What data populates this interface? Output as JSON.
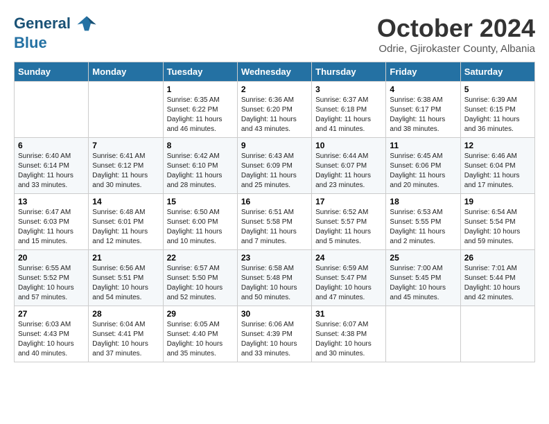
{
  "logo": {
    "line1": "General",
    "line2": "Blue"
  },
  "header": {
    "month": "October 2024",
    "location": "Odrie, Gjirokaster County, Albania"
  },
  "weekdays": [
    "Sunday",
    "Monday",
    "Tuesday",
    "Wednesday",
    "Thursday",
    "Friday",
    "Saturday"
  ],
  "weeks": [
    [
      {
        "day": "",
        "sunrise": "",
        "sunset": "",
        "daylight": ""
      },
      {
        "day": "",
        "sunrise": "",
        "sunset": "",
        "daylight": ""
      },
      {
        "day": "1",
        "sunrise": "Sunrise: 6:35 AM",
        "sunset": "Sunset: 6:22 PM",
        "daylight": "Daylight: 11 hours and 46 minutes."
      },
      {
        "day": "2",
        "sunrise": "Sunrise: 6:36 AM",
        "sunset": "Sunset: 6:20 PM",
        "daylight": "Daylight: 11 hours and 43 minutes."
      },
      {
        "day": "3",
        "sunrise": "Sunrise: 6:37 AM",
        "sunset": "Sunset: 6:18 PM",
        "daylight": "Daylight: 11 hours and 41 minutes."
      },
      {
        "day": "4",
        "sunrise": "Sunrise: 6:38 AM",
        "sunset": "Sunset: 6:17 PM",
        "daylight": "Daylight: 11 hours and 38 minutes."
      },
      {
        "day": "5",
        "sunrise": "Sunrise: 6:39 AM",
        "sunset": "Sunset: 6:15 PM",
        "daylight": "Daylight: 11 hours and 36 minutes."
      }
    ],
    [
      {
        "day": "6",
        "sunrise": "Sunrise: 6:40 AM",
        "sunset": "Sunset: 6:14 PM",
        "daylight": "Daylight: 11 hours and 33 minutes."
      },
      {
        "day": "7",
        "sunrise": "Sunrise: 6:41 AM",
        "sunset": "Sunset: 6:12 PM",
        "daylight": "Daylight: 11 hours and 30 minutes."
      },
      {
        "day": "8",
        "sunrise": "Sunrise: 6:42 AM",
        "sunset": "Sunset: 6:10 PM",
        "daylight": "Daylight: 11 hours and 28 minutes."
      },
      {
        "day": "9",
        "sunrise": "Sunrise: 6:43 AM",
        "sunset": "Sunset: 6:09 PM",
        "daylight": "Daylight: 11 hours and 25 minutes."
      },
      {
        "day": "10",
        "sunrise": "Sunrise: 6:44 AM",
        "sunset": "Sunset: 6:07 PM",
        "daylight": "Daylight: 11 hours and 23 minutes."
      },
      {
        "day": "11",
        "sunrise": "Sunrise: 6:45 AM",
        "sunset": "Sunset: 6:06 PM",
        "daylight": "Daylight: 11 hours and 20 minutes."
      },
      {
        "day": "12",
        "sunrise": "Sunrise: 6:46 AM",
        "sunset": "Sunset: 6:04 PM",
        "daylight": "Daylight: 11 hours and 17 minutes."
      }
    ],
    [
      {
        "day": "13",
        "sunrise": "Sunrise: 6:47 AM",
        "sunset": "Sunset: 6:03 PM",
        "daylight": "Daylight: 11 hours and 15 minutes."
      },
      {
        "day": "14",
        "sunrise": "Sunrise: 6:48 AM",
        "sunset": "Sunset: 6:01 PM",
        "daylight": "Daylight: 11 hours and 12 minutes."
      },
      {
        "day": "15",
        "sunrise": "Sunrise: 6:50 AM",
        "sunset": "Sunset: 6:00 PM",
        "daylight": "Daylight: 11 hours and 10 minutes."
      },
      {
        "day": "16",
        "sunrise": "Sunrise: 6:51 AM",
        "sunset": "Sunset: 5:58 PM",
        "daylight": "Daylight: 11 hours and 7 minutes."
      },
      {
        "day": "17",
        "sunrise": "Sunrise: 6:52 AM",
        "sunset": "Sunset: 5:57 PM",
        "daylight": "Daylight: 11 hours and 5 minutes."
      },
      {
        "day": "18",
        "sunrise": "Sunrise: 6:53 AM",
        "sunset": "Sunset: 5:55 PM",
        "daylight": "Daylight: 11 hours and 2 minutes."
      },
      {
        "day": "19",
        "sunrise": "Sunrise: 6:54 AM",
        "sunset": "Sunset: 5:54 PM",
        "daylight": "Daylight: 10 hours and 59 minutes."
      }
    ],
    [
      {
        "day": "20",
        "sunrise": "Sunrise: 6:55 AM",
        "sunset": "Sunset: 5:52 PM",
        "daylight": "Daylight: 10 hours and 57 minutes."
      },
      {
        "day": "21",
        "sunrise": "Sunrise: 6:56 AM",
        "sunset": "Sunset: 5:51 PM",
        "daylight": "Daylight: 10 hours and 54 minutes."
      },
      {
        "day": "22",
        "sunrise": "Sunrise: 6:57 AM",
        "sunset": "Sunset: 5:50 PM",
        "daylight": "Daylight: 10 hours and 52 minutes."
      },
      {
        "day": "23",
        "sunrise": "Sunrise: 6:58 AM",
        "sunset": "Sunset: 5:48 PM",
        "daylight": "Daylight: 10 hours and 50 minutes."
      },
      {
        "day": "24",
        "sunrise": "Sunrise: 6:59 AM",
        "sunset": "Sunset: 5:47 PM",
        "daylight": "Daylight: 10 hours and 47 minutes."
      },
      {
        "day": "25",
        "sunrise": "Sunrise: 7:00 AM",
        "sunset": "Sunset: 5:45 PM",
        "daylight": "Daylight: 10 hours and 45 minutes."
      },
      {
        "day": "26",
        "sunrise": "Sunrise: 7:01 AM",
        "sunset": "Sunset: 5:44 PM",
        "daylight": "Daylight: 10 hours and 42 minutes."
      }
    ],
    [
      {
        "day": "27",
        "sunrise": "Sunrise: 6:03 AM",
        "sunset": "Sunset: 4:43 PM",
        "daylight": "Daylight: 10 hours and 40 minutes."
      },
      {
        "day": "28",
        "sunrise": "Sunrise: 6:04 AM",
        "sunset": "Sunset: 4:41 PM",
        "daylight": "Daylight: 10 hours and 37 minutes."
      },
      {
        "day": "29",
        "sunrise": "Sunrise: 6:05 AM",
        "sunset": "Sunset: 4:40 PM",
        "daylight": "Daylight: 10 hours and 35 minutes."
      },
      {
        "day": "30",
        "sunrise": "Sunrise: 6:06 AM",
        "sunset": "Sunset: 4:39 PM",
        "daylight": "Daylight: 10 hours and 33 minutes."
      },
      {
        "day": "31",
        "sunrise": "Sunrise: 6:07 AM",
        "sunset": "Sunset: 4:38 PM",
        "daylight": "Daylight: 10 hours and 30 minutes."
      },
      {
        "day": "",
        "sunrise": "",
        "sunset": "",
        "daylight": ""
      },
      {
        "day": "",
        "sunrise": "",
        "sunset": "",
        "daylight": ""
      }
    ]
  ]
}
